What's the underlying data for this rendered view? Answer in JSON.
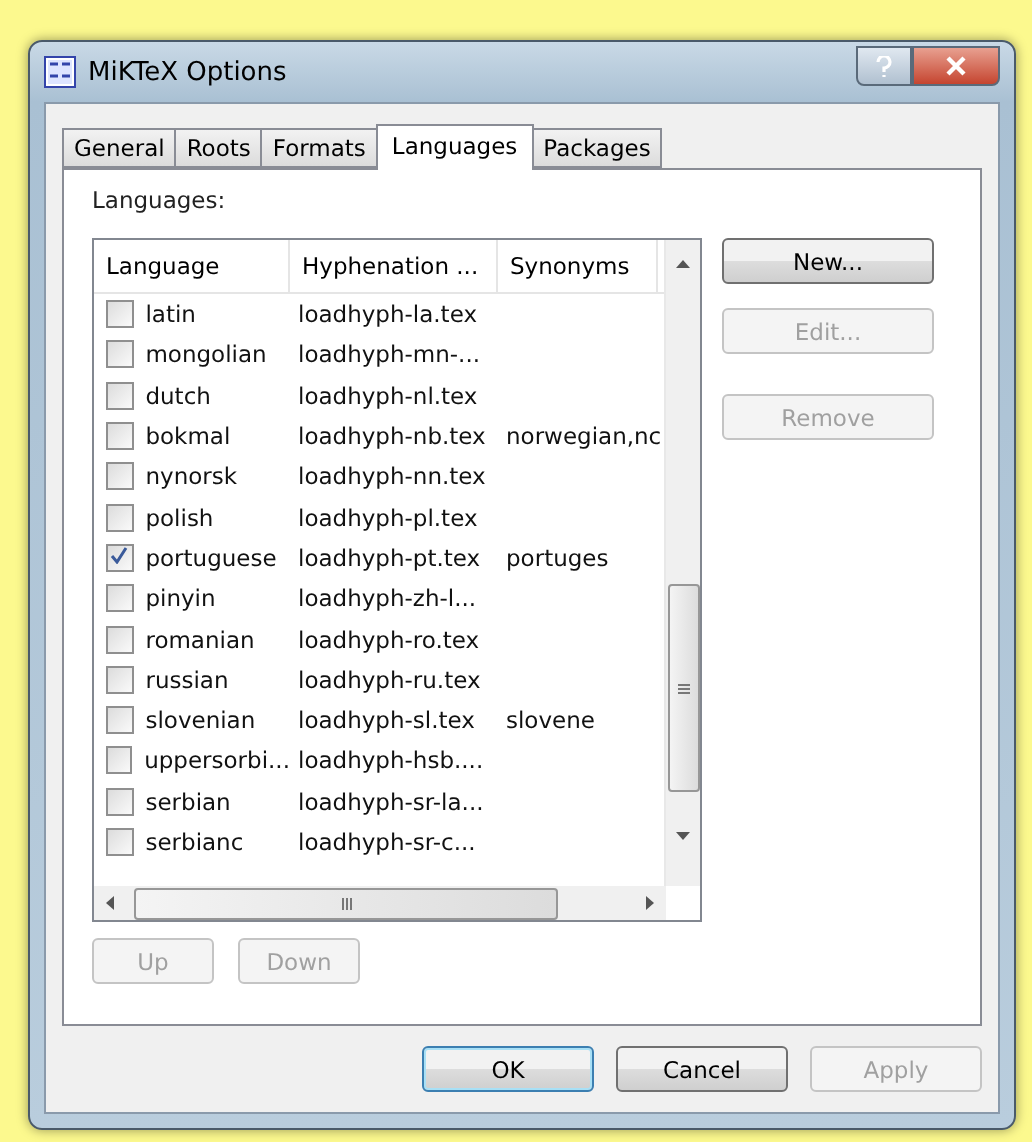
{
  "window": {
    "title": "MiKTeX Options"
  },
  "tabs": [
    {
      "label": "General",
      "selected": false
    },
    {
      "label": "Roots",
      "selected": false
    },
    {
      "label": "Formats",
      "selected": false
    },
    {
      "label": "Languages",
      "selected": true
    },
    {
      "label": "Packages",
      "selected": false
    }
  ],
  "languages_label": "Languages:",
  "table": {
    "columns": [
      "Language",
      "Hyphenation ...",
      "Synonyms"
    ],
    "rows": [
      {
        "language": "latin",
        "file": "loadhyph-la.tex",
        "synonyms": "",
        "checked": false
      },
      {
        "language": "mongolian",
        "file": "loadhyph-mn-...",
        "synonyms": "",
        "checked": false
      },
      {
        "language": "dutch",
        "file": "loadhyph-nl.tex",
        "synonyms": "",
        "checked": false
      },
      {
        "language": "bokmal",
        "file": "loadhyph-nb.tex",
        "synonyms": "norwegian,nc",
        "checked": false
      },
      {
        "language": "nynorsk",
        "file": "loadhyph-nn.tex",
        "synonyms": "",
        "checked": false
      },
      {
        "language": "polish",
        "file": "loadhyph-pl.tex",
        "synonyms": "",
        "checked": false
      },
      {
        "language": "portuguese",
        "file": "loadhyph-pt.tex",
        "synonyms": "portuges",
        "checked": true
      },
      {
        "language": "pinyin",
        "file": "loadhyph-zh-l...",
        "synonyms": "",
        "checked": false
      },
      {
        "language": "romanian",
        "file": "loadhyph-ro.tex",
        "synonyms": "",
        "checked": false
      },
      {
        "language": "russian",
        "file": "loadhyph-ru.tex",
        "synonyms": "",
        "checked": false
      },
      {
        "language": "slovenian",
        "file": "loadhyph-sl.tex",
        "synonyms": "slovene",
        "checked": false
      },
      {
        "language": "uppersorbi...",
        "file": "loadhyph-hsb....",
        "synonyms": "",
        "checked": false
      },
      {
        "language": "serbian",
        "file": "loadhyph-sr-la...",
        "synonyms": "",
        "checked": false
      },
      {
        "language": "serbianc",
        "file": "loadhyph-sr-c...",
        "synonyms": "",
        "checked": false
      }
    ]
  },
  "side_buttons": [
    {
      "label": "New...",
      "disabled": false
    },
    {
      "label": "Edit...",
      "disabled": true
    },
    {
      "label": "Remove",
      "disabled": true
    }
  ],
  "move_buttons": [
    {
      "label": "Up",
      "disabled": true
    },
    {
      "label": "Down",
      "disabled": true
    }
  ],
  "buttons": [
    {
      "label": "OK",
      "disabled": false,
      "default": true
    },
    {
      "label": "Cancel",
      "disabled": false,
      "default": false
    },
    {
      "label": "Apply",
      "disabled": true,
      "default": false
    }
  ]
}
